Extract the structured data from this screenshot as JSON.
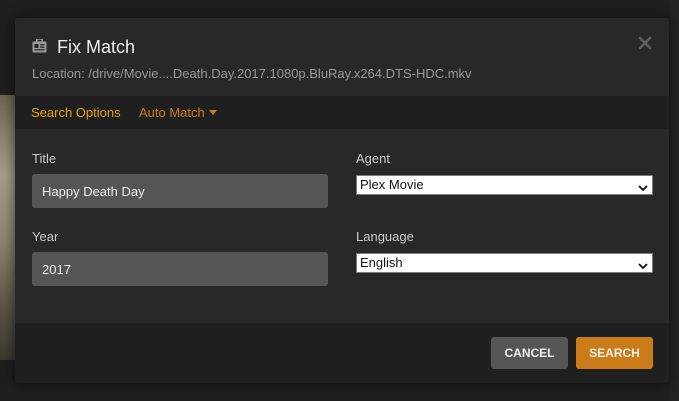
{
  "modal": {
    "title": "Fix Match",
    "location": "Location: /drive/Movie....Death.Day.2017.1080p.BluRay.x264.DTS-HDC.mkv",
    "title_icon": "match-card-icon",
    "close_icon": "close-icon"
  },
  "options_bar": {
    "search_options_label": "Search Options",
    "auto_match_label": "Auto Match"
  },
  "form": {
    "title_label": "Title",
    "title_value": "Happy Death Day",
    "year_label": "Year",
    "year_value": "2017",
    "agent_label": "Agent",
    "agent_value": "Plex Movie",
    "language_label": "Language",
    "language_value": "English"
  },
  "footer": {
    "cancel_label": "CANCEL",
    "search_label": "SEARCH"
  },
  "colors": {
    "accent": "#cc7b19",
    "accent_text": "#e5a00d",
    "modal_bg": "#282828",
    "bar_bg": "#1f1f1f",
    "input_bg": "#555555"
  }
}
